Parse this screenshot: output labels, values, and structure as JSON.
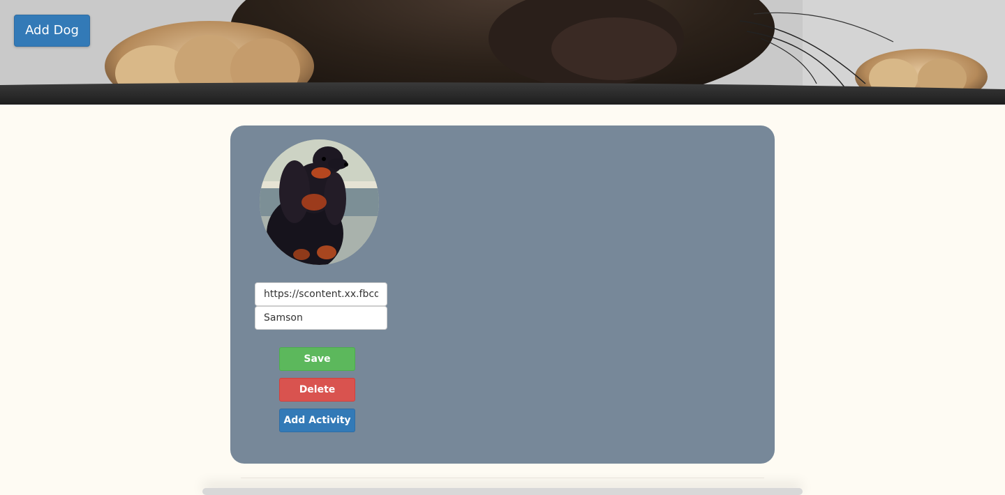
{
  "header": {
    "add_dog_label": "Add Dog"
  },
  "dog_card": {
    "photo_url_value": "https://scontent.xx.fbcd",
    "name_value": "Samson",
    "save_label": "Save",
    "delete_label": "Delete",
    "add_activity_label": "Add Activity"
  },
  "colors": {
    "page_background": "#fefbf3",
    "card_background": "#778899",
    "primary_button": "#337ab7",
    "save_button": "#5cb85c",
    "delete_button": "#d9534f"
  }
}
